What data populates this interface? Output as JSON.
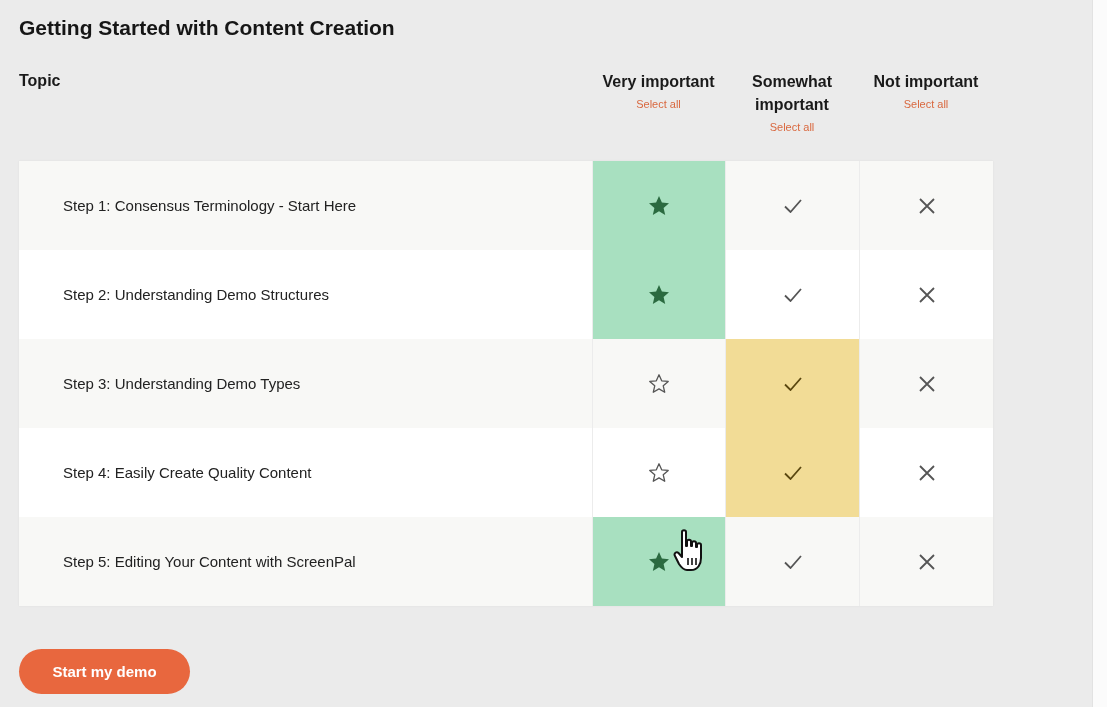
{
  "page": {
    "title": "Getting Started with Content Creation"
  },
  "table": {
    "topic_header": "Topic",
    "columns": [
      {
        "label": "Very important",
        "select_all": "Select all",
        "kind": "star"
      },
      {
        "label": "Somewhat important",
        "select_all": "Select all",
        "kind": "check"
      },
      {
        "label": "Not important",
        "select_all": "Select all",
        "kind": "cross"
      }
    ],
    "rows": [
      {
        "topic": "Step 1: Consensus Terminology - Start Here",
        "options": [
          {
            "selected": true
          },
          {
            "selected": false
          },
          {
            "selected": false
          }
        ]
      },
      {
        "topic": "Step 2: Understanding Demo Structures",
        "options": [
          {
            "selected": true
          },
          {
            "selected": false
          },
          {
            "selected": false
          }
        ]
      },
      {
        "topic": "Step 3: Understanding Demo Types",
        "options": [
          {
            "selected": false
          },
          {
            "selected": true
          },
          {
            "selected": false
          }
        ]
      },
      {
        "topic": "Step 4: Easily Create Quality Content",
        "options": [
          {
            "selected": false
          },
          {
            "selected": true
          },
          {
            "selected": false
          }
        ]
      },
      {
        "topic": "Step 5: Editing Your Content with ScreenPal",
        "options": [
          {
            "selected": true
          },
          {
            "selected": false
          },
          {
            "selected": false
          }
        ]
      }
    ]
  },
  "button": {
    "label": "Start my demo"
  }
}
